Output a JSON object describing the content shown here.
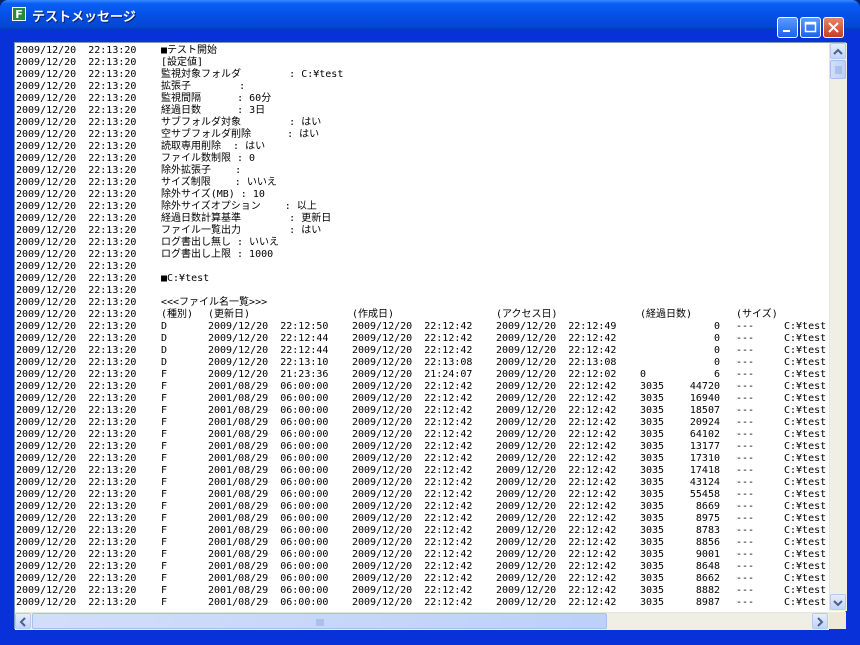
{
  "window": {
    "title": "テストメッセージ",
    "app_icon_letter": "F"
  },
  "log": {
    "header_lines": [
      {
        "time": "2009/12/20  22:13:20",
        "text": "■テスト開始"
      },
      {
        "time": "2009/12/20  22:13:20",
        "text": "[設定値]"
      },
      {
        "time": "2009/12/20  22:13:20",
        "text": "監視対象フォルダ        : C:¥test"
      },
      {
        "time": "2009/12/20  22:13:20",
        "text": "拡張子        :"
      },
      {
        "time": "2009/12/20  22:13:20",
        "text": "監視間隔      : 60分"
      },
      {
        "time": "2009/12/20  22:13:20",
        "text": "経過日数      : 3日"
      },
      {
        "time": "2009/12/20  22:13:20",
        "text": "サブフォルダ対象        : はい"
      },
      {
        "time": "2009/12/20  22:13:20",
        "text": "空サブフォルダ削除      : はい"
      },
      {
        "time": "2009/12/20  22:13:20",
        "text": "読取専用削除  : はい"
      },
      {
        "time": "2009/12/20  22:13:20",
        "text": "ファイル数制限 : 0"
      },
      {
        "time": "2009/12/20  22:13:20",
        "text": "除外拡張子    :"
      },
      {
        "time": "2009/12/20  22:13:20",
        "text": "サイズ制限    : いいえ"
      },
      {
        "time": "2009/12/20  22:13:20",
        "text": "除外サイズ(MB) : 10"
      },
      {
        "time": "2009/12/20  22:13:20",
        "text": "除外サイズオプション    : 以上"
      },
      {
        "time": "2009/12/20  22:13:20",
        "text": "経過日数計算基準        : 更新日"
      },
      {
        "time": "2009/12/20  22:13:20",
        "text": "ファイル一覧出力        : はい"
      },
      {
        "time": "2009/12/20  22:13:20",
        "text": "ログ書出し無し : いいえ"
      },
      {
        "time": "2009/12/20  22:13:20",
        "text": "ログ書出し上限 : 1000"
      },
      {
        "time": "2009/12/20  22:13:20",
        "text": ""
      },
      {
        "time": "2009/12/20  22:13:20",
        "text": "■C:¥test"
      },
      {
        "time": "2009/12/20  22:13:20",
        "text": ""
      },
      {
        "time": "2009/12/20  22:13:20",
        "text": "<<<ファイル名一覧>>>"
      }
    ],
    "table_header": {
      "time": "2009/12/20  22:13:20",
      "type": "(種別)",
      "updated": "(更新日)",
      "created": "(作成日)",
      "accessed": "(アクセス日)",
      "elapsed": "(経過日数)",
      "size": "(サイズ)"
    },
    "rows": [
      {
        "time": "2009/12/20  22:13:20",
        "type": "D",
        "updated": "2009/12/20  22:12:50",
        "created": "2009/12/20  22:12:42",
        "accessed": "2009/12/20  22:12:49",
        "elapsed_a": "",
        "elapsed_b": "0",
        "size": "---",
        "path": "C:¥test"
      },
      {
        "time": "2009/12/20  22:13:20",
        "type": "D",
        "updated": "2009/12/20  22:12:44",
        "created": "2009/12/20  22:12:42",
        "accessed": "2009/12/20  22:12:42",
        "elapsed_a": "",
        "elapsed_b": "0",
        "size": "---",
        "path": "C:¥test"
      },
      {
        "time": "2009/12/20  22:13:20",
        "type": "D",
        "updated": "2009/12/20  22:12:44",
        "created": "2009/12/20  22:12:42",
        "accessed": "2009/12/20  22:12:42",
        "elapsed_a": "",
        "elapsed_b": "0",
        "size": "---",
        "path": "C:¥test"
      },
      {
        "time": "2009/12/20  22:13:20",
        "type": "D",
        "updated": "2009/12/20  22:13:10",
        "created": "2009/12/20  22:13:08",
        "accessed": "2009/12/20  22:13:08",
        "elapsed_a": "",
        "elapsed_b": "0",
        "size": "---",
        "path": "C:¥test"
      },
      {
        "time": "2009/12/20  22:13:20",
        "type": "F",
        "updated": "2009/12/20  21:23:36",
        "created": "2009/12/20  21:24:07",
        "accessed": "2009/12/20  22:12:02",
        "elapsed_a": "0",
        "elapsed_b": "6",
        "size": "---",
        "path": "C:¥test"
      },
      {
        "time": "2009/12/20  22:13:20",
        "type": "F",
        "updated": "2001/08/29  06:00:00",
        "created": "2009/12/20  22:12:42",
        "accessed": "2009/12/20  22:12:42",
        "elapsed_a": "3035",
        "elapsed_b": "44720",
        "size": "---",
        "path": "C:¥test"
      },
      {
        "time": "2009/12/20  22:13:20",
        "type": "F",
        "updated": "2001/08/29  06:00:00",
        "created": "2009/12/20  22:12:42",
        "accessed": "2009/12/20  22:12:42",
        "elapsed_a": "3035",
        "elapsed_b": "16940",
        "size": "---",
        "path": "C:¥test"
      },
      {
        "time": "2009/12/20  22:13:20",
        "type": "F",
        "updated": "2001/08/29  06:00:00",
        "created": "2009/12/20  22:12:42",
        "accessed": "2009/12/20  22:12:42",
        "elapsed_a": "3035",
        "elapsed_b": "18507",
        "size": "---",
        "path": "C:¥test"
      },
      {
        "time": "2009/12/20  22:13:20",
        "type": "F",
        "updated": "2001/08/29  06:00:00",
        "created": "2009/12/20  22:12:42",
        "accessed": "2009/12/20  22:12:42",
        "elapsed_a": "3035",
        "elapsed_b": "20924",
        "size": "---",
        "path": "C:¥test"
      },
      {
        "time": "2009/12/20  22:13:20",
        "type": "F",
        "updated": "2001/08/29  06:00:00",
        "created": "2009/12/20  22:12:42",
        "accessed": "2009/12/20  22:12:42",
        "elapsed_a": "3035",
        "elapsed_b": "64102",
        "size": "---",
        "path": "C:¥test"
      },
      {
        "time": "2009/12/20  22:13:20",
        "type": "F",
        "updated": "2001/08/29  06:00:00",
        "created": "2009/12/20  22:12:42",
        "accessed": "2009/12/20  22:12:42",
        "elapsed_a": "3035",
        "elapsed_b": "13177",
        "size": "---",
        "path": "C:¥test"
      },
      {
        "time": "2009/12/20  22:13:20",
        "type": "F",
        "updated": "2001/08/29  06:00:00",
        "created": "2009/12/20  22:12:42",
        "accessed": "2009/12/20  22:12:42",
        "elapsed_a": "3035",
        "elapsed_b": "17310",
        "size": "---",
        "path": "C:¥test"
      },
      {
        "time": "2009/12/20  22:13:20",
        "type": "F",
        "updated": "2001/08/29  06:00:00",
        "created": "2009/12/20  22:12:42",
        "accessed": "2009/12/20  22:12:42",
        "elapsed_a": "3035",
        "elapsed_b": "17418",
        "size": "---",
        "path": "C:¥test"
      },
      {
        "time": "2009/12/20  22:13:20",
        "type": "F",
        "updated": "2001/08/29  06:00:00",
        "created": "2009/12/20  22:12:42",
        "accessed": "2009/12/20  22:12:42",
        "elapsed_a": "3035",
        "elapsed_b": "43124",
        "size": "---",
        "path": "C:¥test"
      },
      {
        "time": "2009/12/20  22:13:20",
        "type": "F",
        "updated": "2001/08/29  06:00:00",
        "created": "2009/12/20  22:12:42",
        "accessed": "2009/12/20  22:12:42",
        "elapsed_a": "3035",
        "elapsed_b": "55458",
        "size": "---",
        "path": "C:¥test"
      },
      {
        "time": "2009/12/20  22:13:20",
        "type": "F",
        "updated": "2001/08/29  06:00:00",
        "created": "2009/12/20  22:12:42",
        "accessed": "2009/12/20  22:12:42",
        "elapsed_a": "3035",
        "elapsed_b": "8669",
        "size": "---",
        "path": "C:¥test"
      },
      {
        "time": "2009/12/20  22:13:20",
        "type": "F",
        "updated": "2001/08/29  06:00:00",
        "created": "2009/12/20  22:12:42",
        "accessed": "2009/12/20  22:12:42",
        "elapsed_a": "3035",
        "elapsed_b": "8975",
        "size": "---",
        "path": "C:¥test"
      },
      {
        "time": "2009/12/20  22:13:20",
        "type": "F",
        "updated": "2001/08/29  06:00:00",
        "created": "2009/12/20  22:12:42",
        "accessed": "2009/12/20  22:12:42",
        "elapsed_a": "3035",
        "elapsed_b": "8783",
        "size": "---",
        "path": "C:¥test"
      },
      {
        "time": "2009/12/20  22:13:20",
        "type": "F",
        "updated": "2001/08/29  06:00:00",
        "created": "2009/12/20  22:12:42",
        "accessed": "2009/12/20  22:12:42",
        "elapsed_a": "3035",
        "elapsed_b": "8856",
        "size": "---",
        "path": "C:¥test"
      },
      {
        "time": "2009/12/20  22:13:20",
        "type": "F",
        "updated": "2001/08/29  06:00:00",
        "created": "2009/12/20  22:12:42",
        "accessed": "2009/12/20  22:12:42",
        "elapsed_a": "3035",
        "elapsed_b": "9001",
        "size": "---",
        "path": "C:¥test"
      },
      {
        "time": "2009/12/20  22:13:20",
        "type": "F",
        "updated": "2001/08/29  06:00:00",
        "created": "2009/12/20  22:12:42",
        "accessed": "2009/12/20  22:12:42",
        "elapsed_a": "3035",
        "elapsed_b": "8648",
        "size": "---",
        "path": "C:¥test"
      },
      {
        "time": "2009/12/20  22:13:20",
        "type": "F",
        "updated": "2001/08/29  06:00:00",
        "created": "2009/12/20  22:12:42",
        "accessed": "2009/12/20  22:12:42",
        "elapsed_a": "3035",
        "elapsed_b": "8662",
        "size": "---",
        "path": "C:¥test"
      },
      {
        "time": "2009/12/20  22:13:20",
        "type": "F",
        "updated": "2001/08/29  06:00:00",
        "created": "2009/12/20  22:12:42",
        "accessed": "2009/12/20  22:12:42",
        "elapsed_a": "3035",
        "elapsed_b": "8882",
        "size": "---",
        "path": "C:¥test"
      },
      {
        "time": "2009/12/20  22:13:20",
        "type": "F",
        "updated": "2001/08/29  06:00:00",
        "created": "2009/12/20  22:12:42",
        "accessed": "2009/12/20  22:12:42",
        "elapsed_a": "3035",
        "elapsed_b": "8987",
        "size": "---",
        "path": "C:¥test"
      }
    ]
  },
  "colors": {
    "titlebar": "#0550e5",
    "close_button": "#c4401e",
    "background": "#ffffff"
  }
}
